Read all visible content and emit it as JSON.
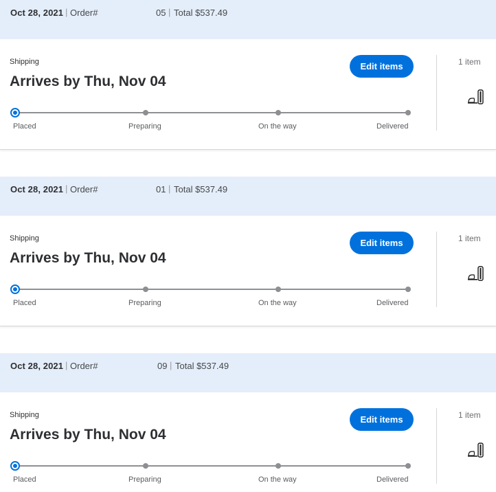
{
  "orders": [
    {
      "date": "Oct 28, 2021",
      "order_label": "Order#",
      "order_number": "05",
      "total": "Total $537.49",
      "shipping_label": "Shipping",
      "arrives": "Arrives by Thu, Nov 04",
      "edit_label": "Edit items",
      "item_count": "1 item",
      "product_icon": "game-console-icon",
      "progress_step": 1,
      "steps": [
        "Placed",
        "Preparing",
        "On the way",
        "Delivered"
      ]
    },
    {
      "date": "Oct 28, 2021",
      "order_label": "Order#",
      "order_number": "01",
      "total": "Total $537.49",
      "shipping_label": "Shipping",
      "arrives": "Arrives by Thu, Nov 04",
      "edit_label": "Edit items",
      "item_count": "1 item",
      "product_icon": "game-console-icon",
      "progress_step": 1,
      "steps": [
        "Placed",
        "Preparing",
        "On the way",
        "Delivered"
      ]
    },
    {
      "date": "Oct 28, 2021",
      "order_label": "Order#",
      "order_number": "09",
      "total": "Total $537.49",
      "shipping_label": "Shipping",
      "arrives": "Arrives by Thu, Nov 04",
      "edit_label": "Edit items",
      "item_count": "1 item",
      "product_icon": "game-console-icon",
      "progress_step": 1,
      "steps": [
        "Placed",
        "Preparing",
        "On the way",
        "Delivered"
      ]
    }
  ],
  "colors": {
    "header_bg": "#e4eefa",
    "accent": "#0071dc",
    "progress_track": "#8e8f92",
    "text": "#2e2f32"
  }
}
